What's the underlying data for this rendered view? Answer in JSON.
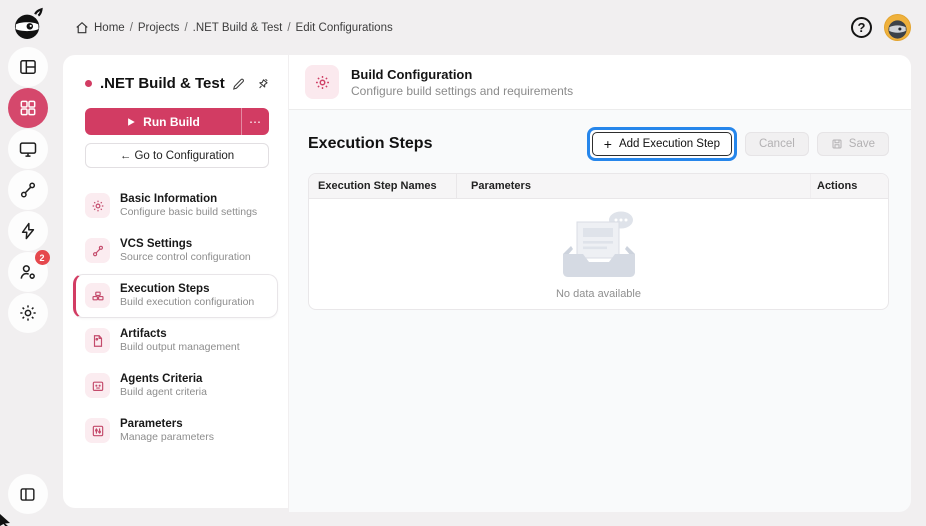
{
  "colors": {
    "accent": "#d23c63",
    "focus_highlight": "#2686eb",
    "badge": "#e5484d",
    "avatar_bg": "#efb13c",
    "page_bg": "#f1eff0"
  },
  "topbar": {
    "breadcrumb_items": [
      "Home",
      "Projects",
      ".NET Build & Test",
      "Edit Configurations"
    ],
    "breadcrumb_separator": "/",
    "help_glyph": "?"
  },
  "rail": {
    "notifications_badge": "2"
  },
  "sidebar": {
    "project_title": ".NET Build & Test",
    "run_label": "Run Build",
    "run_more_glyph": "⋯",
    "goto_label": "← Go to Configuration",
    "items": [
      {
        "label": "Basic Information",
        "desc": "Configure basic build settings"
      },
      {
        "label": "VCS Settings",
        "desc": "Source control configuration"
      },
      {
        "label": "Execution Steps",
        "desc": "Build execution configuration"
      },
      {
        "label": "Artifacts",
        "desc": "Build output management"
      },
      {
        "label": "Agents Criteria",
        "desc": "Build agent criteria"
      },
      {
        "label": "Parameters",
        "desc": "Manage parameters"
      }
    ]
  },
  "main": {
    "header_title": "Build Configuration",
    "header_subtitle": "Configure build settings and requirements",
    "section_title": "Execution Steps",
    "add_button": {
      "plus": "+",
      "label": "Add Execution Step"
    },
    "cancel_label": "Cancel",
    "save_label": "Save",
    "table": {
      "columns": [
        "Execution Step Names",
        "Parameters",
        "Actions"
      ],
      "rows": [],
      "empty_text": "No data available"
    }
  }
}
